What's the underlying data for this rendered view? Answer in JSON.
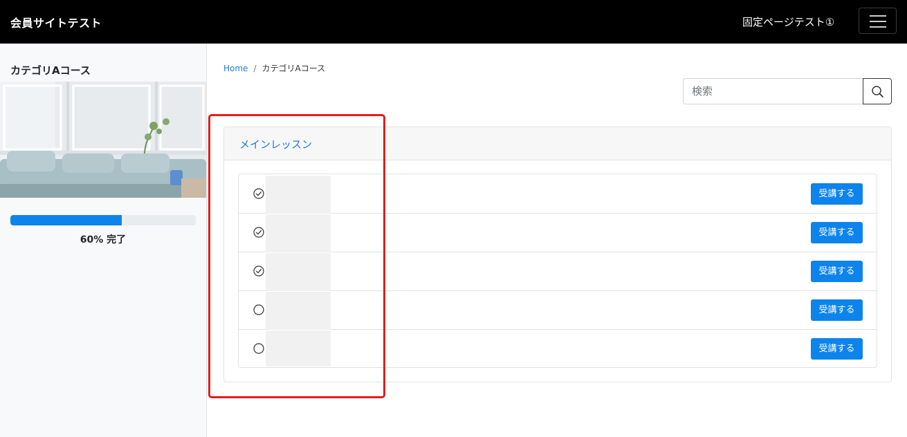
{
  "header": {
    "brand": "会員サイトテスト",
    "nav_link": "固定ページテスト①"
  },
  "sidebar": {
    "course_title": "カテゴリAコース",
    "progress": {
      "percent": 60,
      "label": "60% 完了"
    }
  },
  "breadcrumb": {
    "home": "Home",
    "separator": "/",
    "current": "カテゴリAコース"
  },
  "search": {
    "placeholder": "検索",
    "value": ""
  },
  "lessons": {
    "header": "メインレッスン",
    "items": [
      {
        "completed": true,
        "button_label": "受講する"
      },
      {
        "completed": true,
        "button_label": "受講する"
      },
      {
        "completed": true,
        "button_label": "受講する"
      },
      {
        "completed": false,
        "button_label": "受講する"
      },
      {
        "completed": false,
        "button_label": "受講する"
      }
    ]
  },
  "colors": {
    "accent": "#0d84ec",
    "link": "#1f7ae0",
    "topbar": "#000000",
    "highlight": "#e31d1d"
  }
}
